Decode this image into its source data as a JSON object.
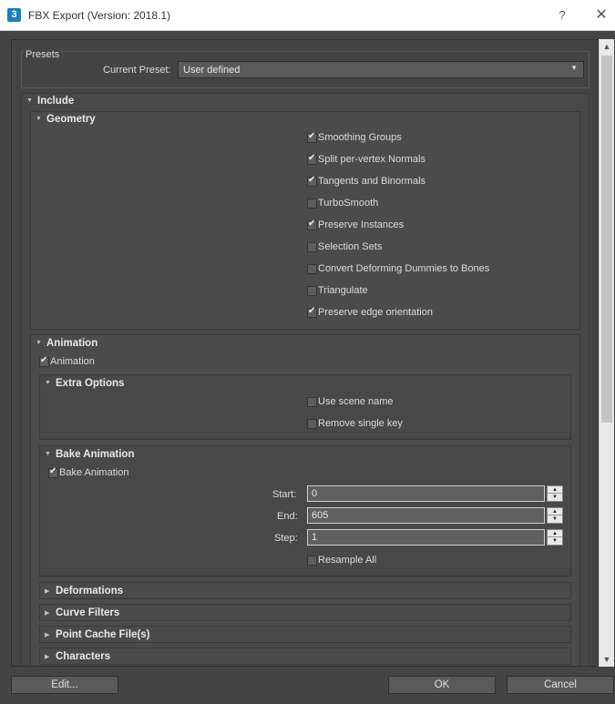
{
  "window": {
    "title": "FBX Export (Version: 2018.1)",
    "app_icon": "3",
    "help": "?",
    "close": "✕"
  },
  "presets": {
    "group_label": "Presets",
    "current_preset_label": "Current Preset:",
    "current_preset_value": "User defined"
  },
  "include": {
    "title": "Include",
    "geometry": {
      "title": "Geometry",
      "options": [
        {
          "label": "Smoothing Groups",
          "checked": true
        },
        {
          "label": "Split per-vertex Normals",
          "checked": true
        },
        {
          "label": "Tangents and Binormals",
          "checked": true
        },
        {
          "label": "TurboSmooth",
          "checked": false
        },
        {
          "label": "Preserve Instances",
          "checked": true
        },
        {
          "label": "Selection Sets",
          "checked": false
        },
        {
          "label": "Convert Deforming Dummies to Bones",
          "checked": false
        },
        {
          "label": "Triangulate",
          "checked": false
        },
        {
          "label": "Preserve edge orientation",
          "checked": true
        }
      ]
    },
    "animation": {
      "title": "Animation",
      "animation_checkbox": {
        "label": "Animation",
        "checked": true
      },
      "extra_options": {
        "title": "Extra Options",
        "options": [
          {
            "label": "Use scene name",
            "checked": false
          },
          {
            "label": "Remove single key",
            "checked": false
          }
        ]
      },
      "bake_animation": {
        "title": "Bake Animation",
        "bake_checkbox": {
          "label": "Bake Animation",
          "checked": true
        },
        "start_label": "Start:",
        "start_value": "0",
        "end_label": "End:",
        "end_value": "605",
        "step_label": "Step:",
        "step_value": "1",
        "resample": {
          "label": "Resample All",
          "checked": false
        }
      },
      "collapsed": [
        "Deformations",
        "Curve Filters",
        "Point Cache File(s)",
        "Characters"
      ]
    }
  },
  "footer": {
    "edit_label": "Edit...",
    "ok_label": "OK",
    "cancel_label": "Cancel"
  }
}
